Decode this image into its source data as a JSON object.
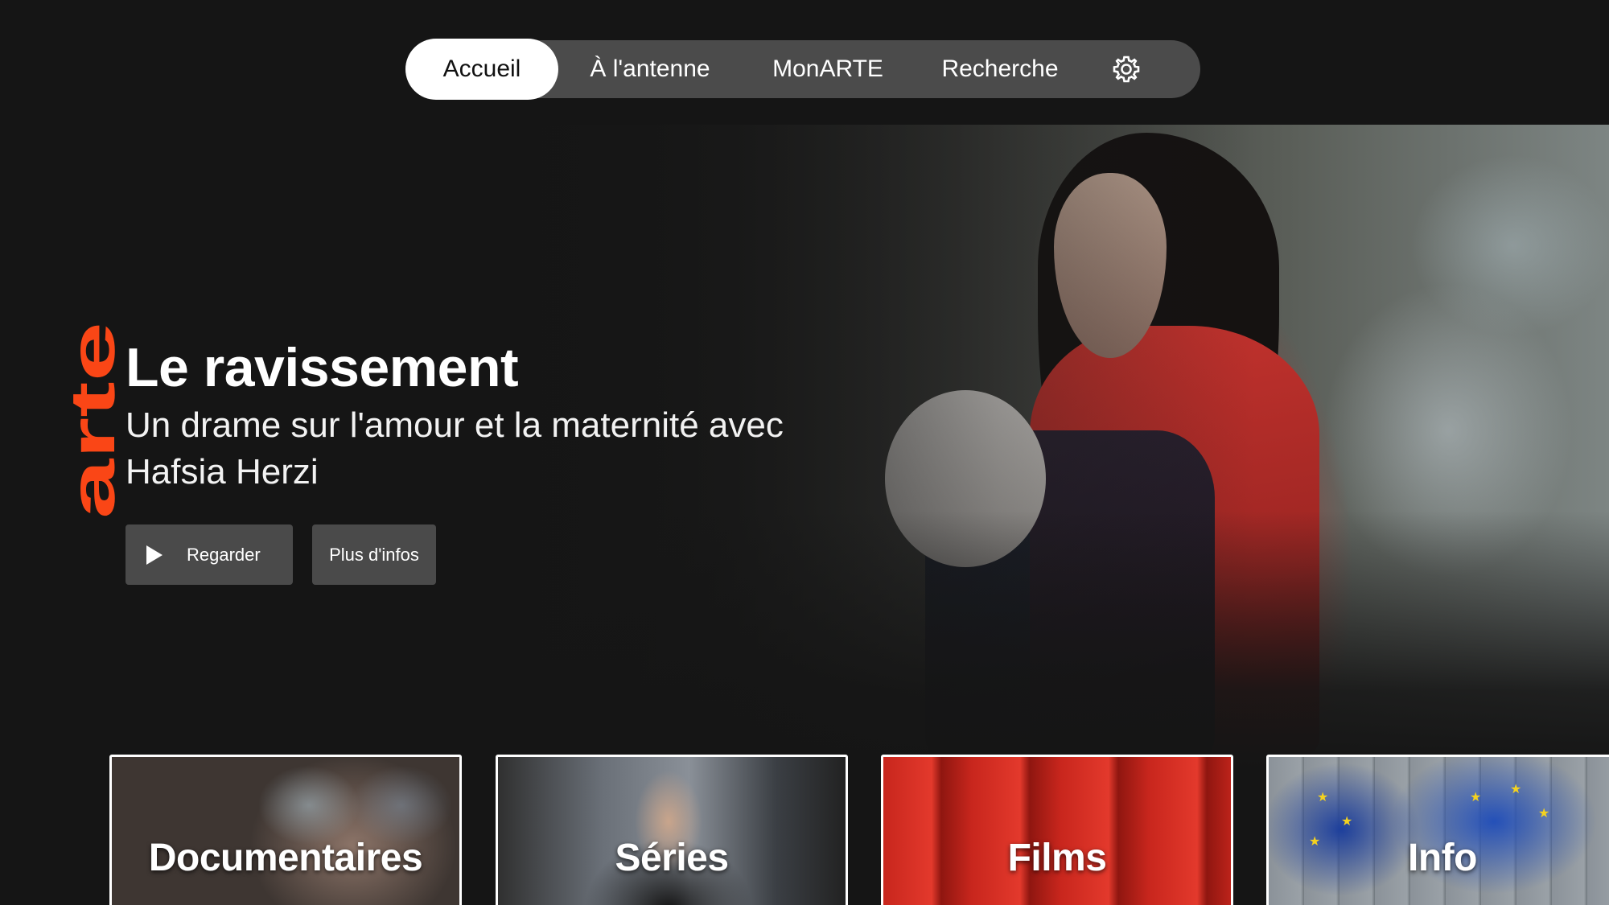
{
  "nav": {
    "tabs": [
      {
        "label": "Accueil",
        "selected": true
      },
      {
        "label": "À l'antenne",
        "selected": false
      },
      {
        "label": "MonARTE",
        "selected": false
      },
      {
        "label": "Recherche",
        "selected": false
      }
    ],
    "settings_icon": "gear-icon"
  },
  "brand": {
    "logo_text": "arte",
    "logo_color": "#FA4616"
  },
  "hero": {
    "title": "Le ravissement",
    "subtitle": "Un drame sur l'amour et la maternité avec Hafsia Herzi",
    "buttons": {
      "watch_label": "Regarder",
      "watch_icon": "play-icon",
      "more_info_label": "Plus d'infos"
    }
  },
  "categories": [
    {
      "label": "Documentaires"
    },
    {
      "label": "Séries"
    },
    {
      "label": "Films"
    },
    {
      "label": "Info"
    }
  ],
  "colors": {
    "background": "#151515",
    "nav_pill": "#4B4B4B",
    "selected_tab": "#FFFFFF",
    "button": "#4A4A4A"
  }
}
